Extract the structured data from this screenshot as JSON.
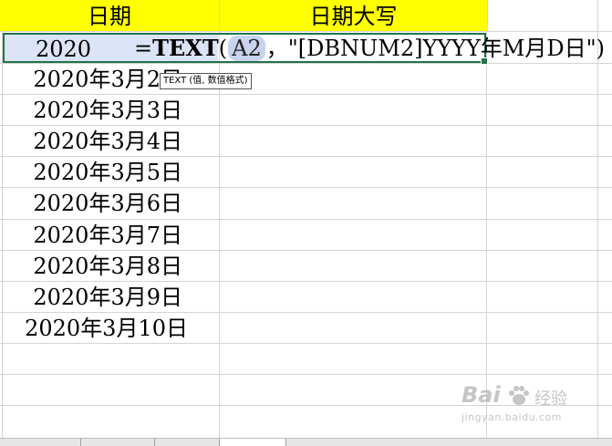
{
  "headers": {
    "col_a": "日期",
    "col_b": "日期大写"
  },
  "active_cell": {
    "value": "2020",
    "formula_prefix": "=",
    "formula_fn": "TEXT",
    "formula_open": "(",
    "formula_ref": "A2",
    "formula_rest": "，\"[DBNUM2]YYYY年M月D日\")"
  },
  "tooltip": "TEXT (值, 数值格式)",
  "dates": [
    "2020年3月2日",
    "2020年3月3日",
    "2020年3月4日",
    "2020年3月5日",
    "2020年3月6日",
    "2020年3月7日",
    "2020年3月8日",
    "2020年3月9日",
    "2020年3月10日"
  ],
  "watermark": {
    "brand": "Bai",
    "tail": "经验",
    "url": "jingyan.baidu.com"
  },
  "colors": {
    "header_bg": "#ffff00",
    "selection": "#217346",
    "ref_highlight": "#c8d3ee"
  }
}
